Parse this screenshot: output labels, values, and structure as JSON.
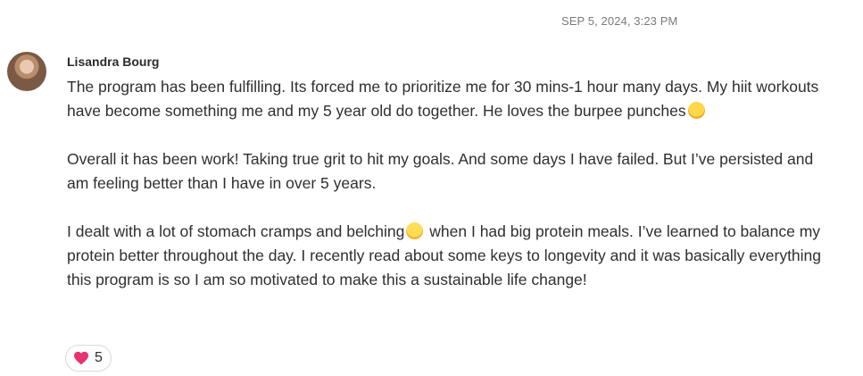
{
  "post": {
    "timestamp": "SEP 5, 2024, 3:23 PM",
    "author": "Lisandra Bourg",
    "paragraph1_a": "The program has been fulfilling. Its forced me to prioritize me for 30 mins-1 hour many days. My hiit workouts have become something me and my 5 year old do together. He loves the burpee punches",
    "paragraph2": "Overall it has been work! Taking true grit to hit my goals. And some days I have failed. But I’ve persisted and am feeling better than I have in over 5 years.",
    "paragraph3_a": "I dealt with a lot of stomach cramps and belching",
    "paragraph3_b": " when I had big protein meals. I’ve learned to balance my protein better throughout the day. I recently read about some keys to longevity and it was basically everything this program is so I am so motivated to make this a sustainable life change!",
    "emojis": [
      "rolling-on-floor-laughing-emoji",
      "grimacing-emoji"
    ]
  },
  "reactions": {
    "icon": "heart-icon",
    "count": "5",
    "color": "#e8336f"
  }
}
